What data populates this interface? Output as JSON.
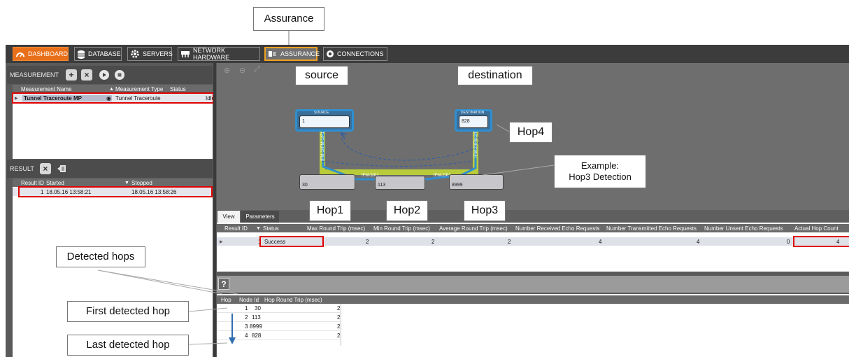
{
  "callouts": {
    "assurance": "Assurance",
    "source": "source",
    "destination": "destination",
    "hop4": "Hop4",
    "example_line1": "Example:",
    "example_line2": "Hop3 Detection",
    "hop1": "Hop1",
    "hop2": "Hop2",
    "hop3": "Hop3",
    "detected_hops": "Detected hops",
    "first_detected_hop": "First detected hop",
    "last_detected_hop": "Last detected hop"
  },
  "nav": {
    "items": [
      {
        "label": "DASHBOARD",
        "icon": "dashboard-icon"
      },
      {
        "label": "DATABASE",
        "icon": "database-icon"
      },
      {
        "label": "SERVERS",
        "icon": "gear-icon"
      },
      {
        "label": "NETWORK HARDWARE",
        "icon": "network-hardware-icon"
      },
      {
        "label": "ASSURANCE",
        "icon": "assurance-icon"
      },
      {
        "label": "CONNECTIONS",
        "icon": "connections-icon"
      }
    ]
  },
  "measurement": {
    "title": "MEASUREMENT",
    "columns": [
      "Measurement Name",
      "Measurement Type",
      "Status"
    ],
    "rows": [
      {
        "name": "Tunnel Traceroute MP",
        "type": "Tunnel Traceroute",
        "status": "Idle"
      }
    ]
  },
  "result": {
    "title": "RESULT",
    "columns": [
      "Result ID",
      "Started",
      "Stopped"
    ],
    "rows": [
      {
        "id": "1",
        "started": "18.05.16 13:58:21",
        "stopped": "18.05.16 13:58:26"
      }
    ]
  },
  "canvas": {
    "source_label": "SOURCE",
    "source_value": "1",
    "destination_label": "DESTINATION",
    "destination_value": "828",
    "hop_nodes": [
      "30",
      "113",
      "8999"
    ],
    "link_labels": [
      "IFM-1/IFM-1/P1",
      "IFM-3/P1",
      "IFM-2/P1",
      "IFM-2/IFM-2/P1"
    ],
    "colors": {
      "green": "#b8cc3a",
      "blue": "#2f8fd0",
      "dash": "#2d5ea8"
    }
  },
  "tabs": [
    "View",
    "Parameters"
  ],
  "results_table": {
    "columns": [
      "Result ID",
      "Status",
      "Max Round Trip (msec)",
      "Min Round Trip (msec)",
      "Average Round Trip (msec)",
      "Number Received Echo Requests",
      "Number Transmitted Echo Requests",
      "Number Unsent Echo Requests",
      "Actual Hop Count"
    ],
    "row": {
      "id": "1",
      "status": "Success",
      "max": "2",
      "min": "2",
      "avg": "2",
      "received": "4",
      "transmitted": "4",
      "unsent": "0",
      "hop_count": "4"
    }
  },
  "help_label": "?",
  "hop_table": {
    "columns": [
      "Hop",
      "Node Id",
      "Hop Round Trip (msec)"
    ],
    "rows": [
      {
        "hop": "1",
        "node": "30",
        "rtt": "2"
      },
      {
        "hop": "2",
        "node": "113",
        "rtt": "2"
      },
      {
        "hop": "3",
        "node": "8999",
        "rtt": "2"
      },
      {
        "hop": "4",
        "node": "828",
        "rtt": "2"
      }
    ]
  }
}
